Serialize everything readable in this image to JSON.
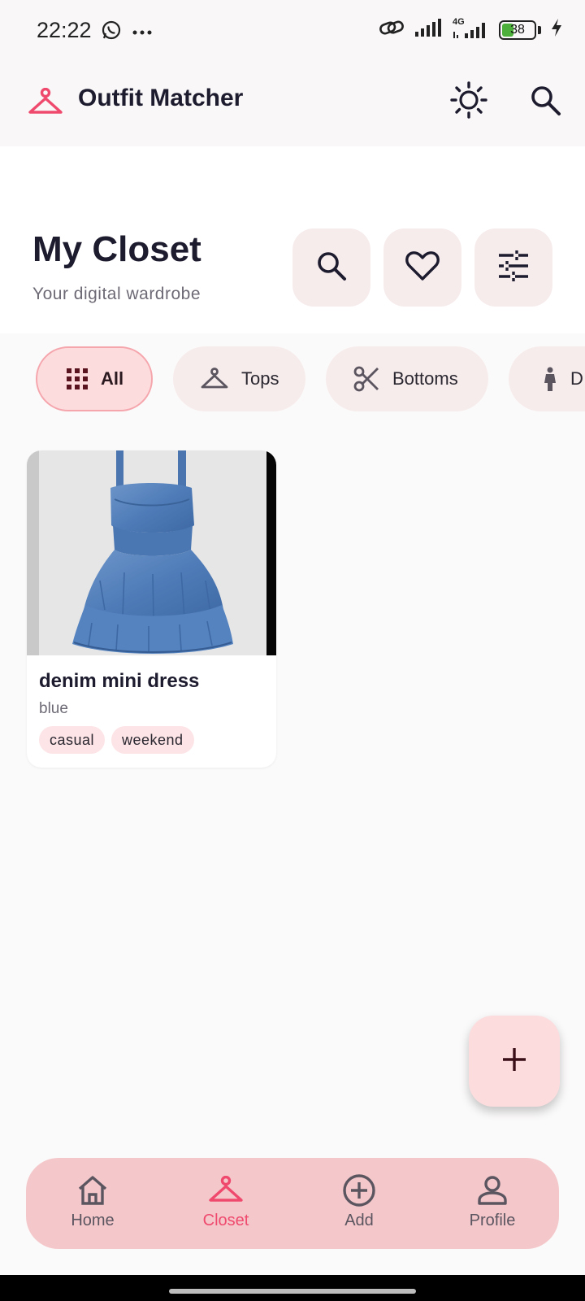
{
  "status_bar": {
    "time": "22:22",
    "network": "4G",
    "battery_percent": "38",
    "battery_level": 0.38,
    "icons": [
      "whatsapp-icon",
      "more-dots-icon",
      "link-icon",
      "signal-icon",
      "signal-4g-icon",
      "battery-icon",
      "charging-icon"
    ]
  },
  "app_bar": {
    "title": "Outfit Matcher",
    "icons": [
      "hanger-logo-icon",
      "theme-toggle-icon",
      "search-icon"
    ]
  },
  "header": {
    "title": "My Closet",
    "subtitle": "Your digital wardrobe",
    "actions": [
      "search-icon",
      "heart-icon",
      "filter-sliders-icon"
    ]
  },
  "chips": [
    {
      "label": "All",
      "icon": "grid-icon",
      "selected": true
    },
    {
      "label": "Tops",
      "icon": "hanger-icon",
      "selected": false
    },
    {
      "label": "Bottoms",
      "icon": "scissors-icon",
      "selected": false
    },
    {
      "label": "D",
      "icon": "person-icon",
      "selected": false
    }
  ],
  "items": [
    {
      "name": "denim mini dress",
      "color": "blue",
      "tags": [
        "casual",
        "weekend"
      ]
    }
  ],
  "fab": {
    "icon": "plus-icon"
  },
  "bottom_nav": [
    {
      "label": "Home",
      "icon": "home-icon",
      "active": false
    },
    {
      "label": "Closet",
      "icon": "hanger-icon",
      "active": true
    },
    {
      "label": "Add",
      "icon": "add-circle-icon",
      "active": false
    },
    {
      "label": "Profile",
      "icon": "profile-icon",
      "active": false
    }
  ],
  "colors": {
    "accent": "#ef4a6e",
    "chip_selected_bg": "#fddcde",
    "chip_bg": "#f7ecec",
    "nav_bg": "#f4c8cb",
    "text_primary": "#1d1b2e",
    "text_secondary": "#6e6a75"
  }
}
